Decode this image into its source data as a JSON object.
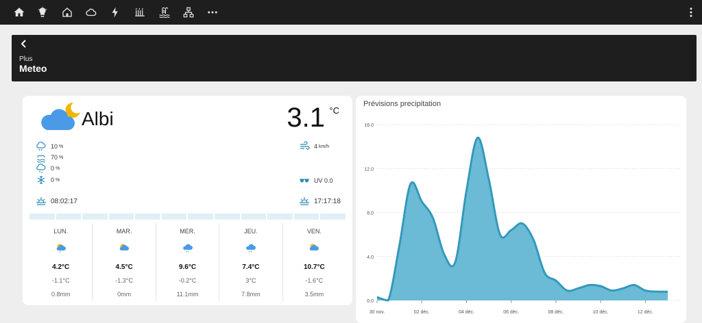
{
  "topbar": {
    "icons": [
      "home-icon",
      "lightbulb-icon",
      "house-icon",
      "cloud-icon",
      "lightning-icon",
      "heater-icon",
      "pool-icon",
      "network-icon",
      "more-icon",
      "menu-icon"
    ]
  },
  "header": {
    "subtitle": "Plus",
    "title": "Meteo"
  },
  "weather": {
    "city": "Albi",
    "temperature": "3.1",
    "temp_unit": "°C",
    "precip_prob": "10",
    "precip_prob_unit": "%",
    "humidity": "70",
    "humidity_unit": "%",
    "rain_prob": "0",
    "rain_prob_unit": "%",
    "snow_prob": "0",
    "snow_prob_unit": "%",
    "wind": "4",
    "wind_unit": "km/h",
    "uv": "UV 0.0",
    "sunrise": "08:02:17",
    "sunset": "17:17:18",
    "forecast": [
      {
        "day": "LUN.",
        "max": "4.2°C",
        "min": "-1.1°C",
        "precip": "0.8mm"
      },
      {
        "day": "MAR.",
        "max": "4.5°C",
        "min": "-1.3°C",
        "precip": "0mm"
      },
      {
        "day": "MER.",
        "max": "9.6°C",
        "min": "-0.2°C",
        "precip": "11.1mm"
      },
      {
        "day": "JEU.",
        "max": "7.4°C",
        "min": "3°C",
        "precip": "7.8mm"
      },
      {
        "day": "VEN.",
        "max": "10.7°C",
        "min": "-1.6°C",
        "precip": "3.5mm"
      }
    ]
  },
  "chart_data": {
    "type": "area",
    "title": "Prévisions precipitation",
    "color": "#3399bb",
    "fill": "#6bbbd6",
    "ylim": [
      0,
      16
    ],
    "yticks": [
      "0.0",
      "4.0",
      "8.0",
      "12.0",
      "16.0"
    ],
    "xticks": [
      "30 nov.",
      "02 déc.",
      "04 déc.",
      "06 déc.",
      "08 déc.",
      "10 déc.",
      "12 déc."
    ],
    "x": [
      0,
      0.5,
      1,
      1.5,
      2,
      2.5,
      3,
      3.5,
      4,
      4.5,
      5,
      5.5,
      6,
      6.5,
      7,
      7.5,
      8,
      8.5,
      9,
      9.5,
      10,
      10.5,
      11,
      11.5,
      12,
      12.5,
      13
    ],
    "values": [
      0.3,
      0,
      5,
      10.6,
      9,
      7.5,
      4.2,
      3.5,
      10,
      14.8,
      11,
      6,
      6.4,
      7,
      5.5,
      2.5,
      1.8,
      0.9,
      1.1,
      1.4,
      1.3,
      0.9,
      1.1,
      1.4,
      0.9,
      0.8,
      0.8
    ]
  }
}
